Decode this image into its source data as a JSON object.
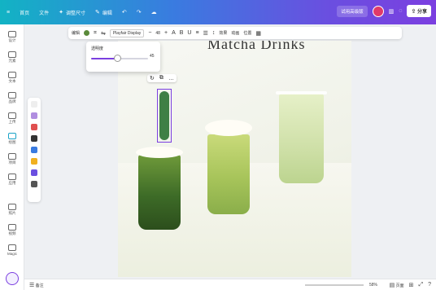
{
  "topbar": {
    "items": [
      {
        "label": "首页",
        "icon": "home-icon"
      },
      {
        "label": "文件",
        "icon": "file-icon"
      },
      {
        "label": "调整尺寸",
        "icon": "resize-icon"
      },
      {
        "label": "编辑",
        "icon": "pencil-icon"
      }
    ],
    "upgrade": "试用高级版",
    "share": "分享"
  },
  "rail": {
    "items": [
      "设计",
      "元素",
      "文本",
      "品牌",
      "上传",
      "绘图",
      "项目",
      "应用",
      "照片",
      "视频",
      "Magic"
    ]
  },
  "etool": {
    "edit": "编辑",
    "font": "Playfair Display",
    "size": "48",
    "effects": "效果",
    "animate": "动画",
    "position": "位置"
  },
  "popover": {
    "label": "透明度",
    "value": 45
  },
  "status": {
    "notes": "备注",
    "zoom": "58%",
    "pages": "页面"
  },
  "canvas": {
    "heading": "Matcha Drinks"
  },
  "colors": {
    "accent": "#7b3fe0",
    "brand_start": "#12b3c4",
    "brand_end": "#7b3fe0"
  }
}
